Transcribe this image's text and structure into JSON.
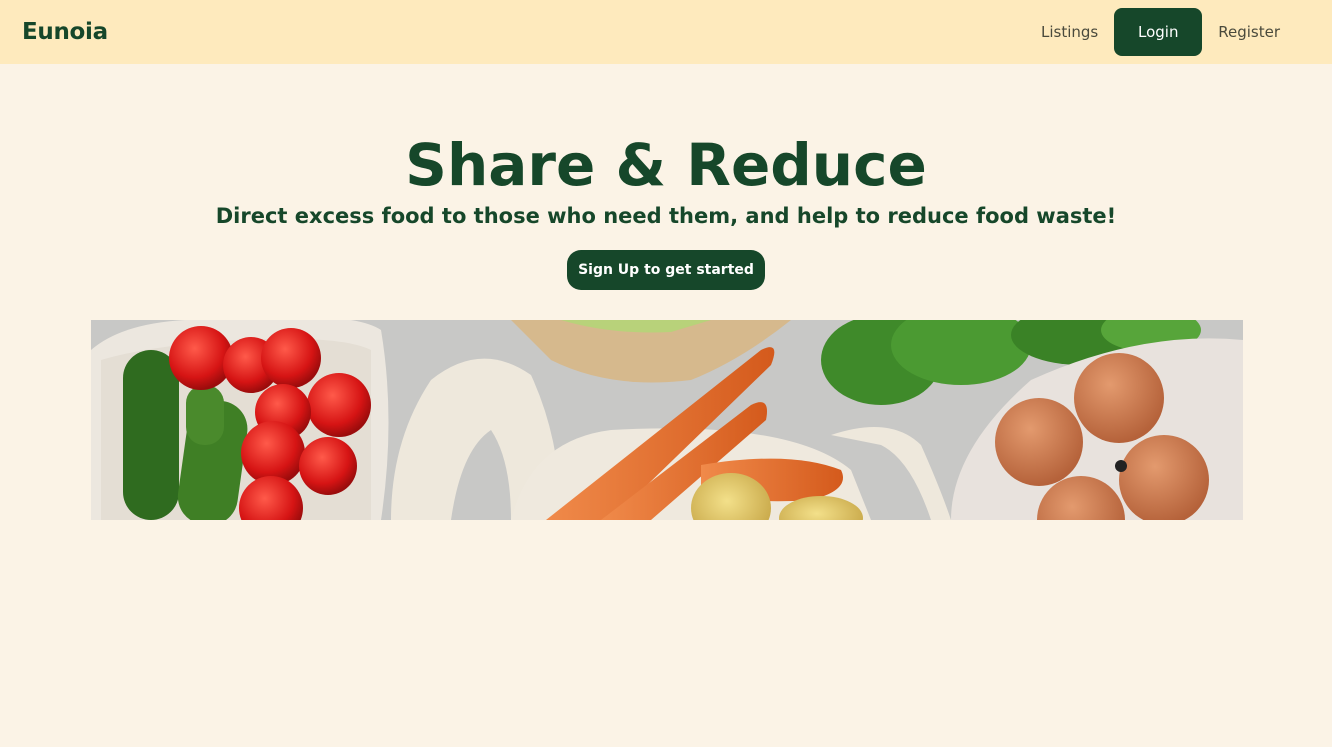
{
  "navbar": {
    "brand": "Eunoia",
    "links": {
      "listings": "Listings",
      "login": "Login",
      "register": "Register"
    }
  },
  "hero": {
    "title": "Share & Reduce",
    "subtitle": "Direct excess food to those who need them, and help to reduce food waste!",
    "cta": "Sign Up to get started"
  },
  "colors": {
    "navbar_bg": "#feeabd",
    "page_bg": "#fbf3e6",
    "brand_green": "#16472a"
  }
}
